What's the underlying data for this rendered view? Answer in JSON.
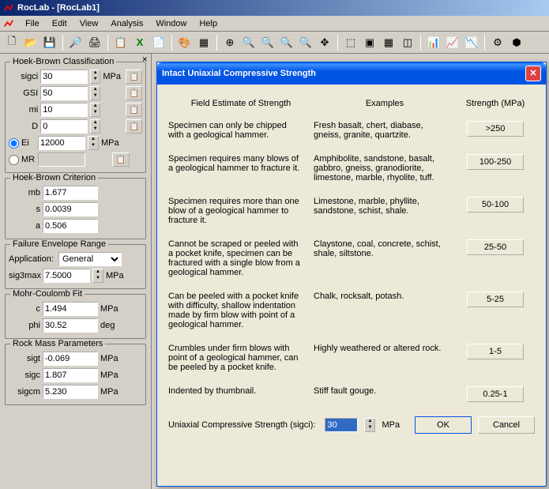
{
  "title": "RocLab - [RocLab1]",
  "menus": [
    "File",
    "Edit",
    "View",
    "Analysis",
    "Window",
    "Help"
  ],
  "sidebar": {
    "groups": {
      "hbclass": {
        "legend": "Hoek-Brown Classification",
        "rows": [
          {
            "label": "sigci",
            "value": "30",
            "unit": "MPa"
          },
          {
            "label": "GSI",
            "value": "50",
            "unit": ""
          },
          {
            "label": "mi",
            "value": "10",
            "unit": ""
          },
          {
            "label": "D",
            "value": "0",
            "unit": ""
          }
        ],
        "radio_ei": "Ei",
        "ei_value": "12000",
        "ei_unit": "MPa",
        "radio_mr": "MR"
      },
      "hbcrit": {
        "legend": "Hoek-Brown Criterion",
        "rows": [
          {
            "label": "mb",
            "value": "1.677"
          },
          {
            "label": "s",
            "value": "0.0039"
          },
          {
            "label": "a",
            "value": "0.506"
          }
        ]
      },
      "fer": {
        "legend": "Failure Envelope Range",
        "app_label": "Application:",
        "app_value": "General",
        "sig3max_label": "sig3max",
        "sig3max_value": "7.5000",
        "sig3max_unit": "MPa"
      },
      "mcfit": {
        "legend": "Mohr-Coulomb Fit",
        "rows": [
          {
            "label": "c",
            "value": "1.494",
            "unit": "MPa"
          },
          {
            "label": "phi",
            "value": "30.52",
            "unit": "deg"
          }
        ]
      },
      "rmp": {
        "legend": "Rock Mass Parameters",
        "rows": [
          {
            "label": "sigt",
            "value": "-0.069",
            "unit": "MPa"
          },
          {
            "label": "sigc",
            "value": "1.807",
            "unit": "MPa"
          },
          {
            "label": "sigcm",
            "value": "5.230",
            "unit": "MPa"
          }
        ]
      }
    }
  },
  "dialog": {
    "title": "Intact Uniaxial Compressive Strength",
    "headers": {
      "est": "Field Estimate of Strength",
      "ex": "Examples",
      "str": "Strength (MPa)"
    },
    "rows": [
      {
        "est": "Specimen can only be chipped with a geological hammer.",
        "ex": "Fresh basalt, chert, diabase, gneiss, granite, quartzite.",
        "btn": ">250"
      },
      {
        "est": "Specimen requires many blows of a geological hammer to fracture it.",
        "ex": "Amphibolite, sandstone, basalt, gabbro, gneiss, granodiorite, limestone, marble, rhyolite, tuff.",
        "btn": "100-250"
      },
      {
        "est": "Specimen requires more than one blow of a geological hammer to fracture it.",
        "ex": "Limestone, marble, phyllite, sandstone, schist, shale.",
        "btn": "50-100"
      },
      {
        "est": "Cannot be scraped or peeled with a pocket knife, specimen can be fractured with a single blow from a geological hammer.",
        "ex": "Claystone, coal, concrete, schist, shale, siltstone.",
        "btn": "25-50"
      },
      {
        "est": "Can be peeled with a pocket knife with difficulty, shallow indentation made by firm blow with point of a geological hammer.",
        "ex": "Chalk, rocksalt, potash.",
        "btn": "5-25"
      },
      {
        "est": "Crumbles under firm blows with point of a geological hammer, can be peeled by a pocket knife.",
        "ex": "Highly weathered or altered rock.",
        "btn": "1-5"
      },
      {
        "est": "Indented by thumbnail.",
        "ex": "Stiff fault gouge.",
        "btn": "0.25-1"
      }
    ],
    "footer": {
      "label": "Uniaxial Compressive Strength (sigci):",
      "value": "30",
      "unit": "MPa",
      "ok": "OK",
      "cancel": "Cancel"
    }
  }
}
